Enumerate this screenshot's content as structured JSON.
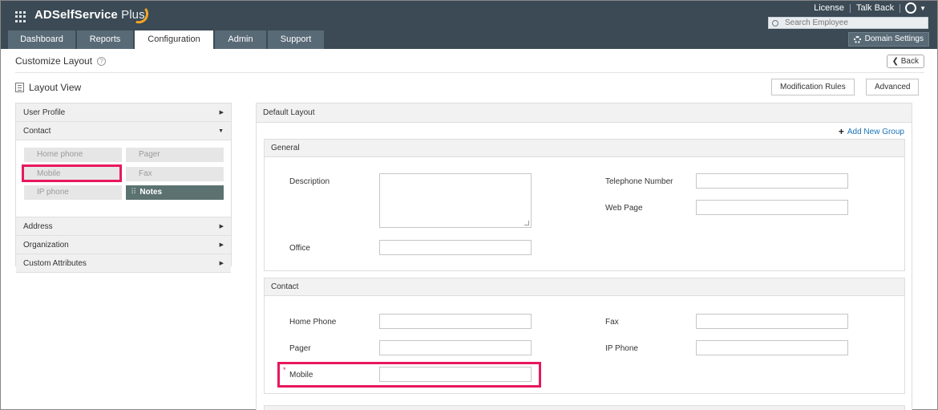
{
  "header": {
    "app_name": "ADSelfService",
    "app_name_suffix": "Plus",
    "links": {
      "license": "License",
      "talk_back": "Talk Back"
    },
    "search_placeholder": "Search Employee",
    "tabs": [
      {
        "label": "Dashboard",
        "active": false
      },
      {
        "label": "Reports",
        "active": false
      },
      {
        "label": "Configuration",
        "active": true
      },
      {
        "label": "Admin",
        "active": false
      },
      {
        "label": "Support",
        "active": false
      }
    ],
    "domain_settings": "Domain Settings"
  },
  "page": {
    "title": "Customize Layout",
    "help_glyph": "?",
    "back_label": "Back",
    "layout_view": "Layout View",
    "modification_rules": "Modification Rules",
    "advanced": "Advanced"
  },
  "left_panel": {
    "sections_top": [
      {
        "label": "User Profile",
        "expanded": false
      },
      {
        "label": "Contact",
        "expanded": true
      }
    ],
    "contact_fields": [
      {
        "label": "Home phone",
        "used": false
      },
      {
        "label": "Pager",
        "used": false
      },
      {
        "label": "Mobile",
        "used": false,
        "highlighted": true
      },
      {
        "label": "Fax",
        "used": false
      },
      {
        "label": "IP phone",
        "used": false
      },
      {
        "label": "Notes",
        "used": true
      }
    ],
    "sections_bottom": [
      {
        "label": "Address"
      },
      {
        "label": "Organization"
      },
      {
        "label": "Custom Attributes"
      }
    ]
  },
  "right_panel": {
    "title": "Default Layout",
    "add_group": "Add New Group",
    "groups": {
      "general": {
        "title": "General",
        "fields": {
          "description": "Description",
          "telephone_number": "Telephone Number",
          "web_page": "Web Page",
          "office": "Office"
        }
      },
      "contact": {
        "title": "Contact",
        "fields": {
          "home_phone": "Home Phone",
          "fax": "Fax",
          "pager": "Pager",
          "ip_phone": "IP Phone",
          "mobile": "Mobile",
          "required_mark": "*"
        }
      }
    }
  },
  "colors": {
    "header_bg": "#3b4a55",
    "tab_bg": "#596a77",
    "highlight": "#e8175d",
    "link": "#1a73b8",
    "used_field": "#5b7271"
  },
  "icons": [
    "apps-grid-icon",
    "user-icon",
    "search-icon",
    "gear-icon",
    "help-icon",
    "chevron-left-icon",
    "layout-view-icon",
    "chevron-right-icon",
    "chevron-down-icon",
    "plus-icon",
    "drag-handle-icon"
  ]
}
